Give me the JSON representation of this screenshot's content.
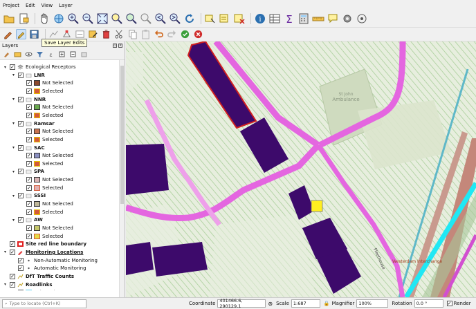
{
  "menu": [
    "Project",
    "Edit",
    "View",
    "Layer"
  ],
  "tooltip": "Save Layer Edits",
  "layers_panel": {
    "title": "Layers",
    "tree": [
      {
        "level": 0,
        "twisty": "▾",
        "checked": true,
        "kind": "group",
        "label": "Ecological Receptors",
        "bold": false
      },
      {
        "level": 1,
        "twisty": "▾",
        "checked": true,
        "kind": "layer",
        "label": "LNR",
        "bold": true
      },
      {
        "level": 2,
        "checked": true,
        "kind": "symbol",
        "fill": "#8b4a2e",
        "border": "#333333",
        "label": "Not Selected"
      },
      {
        "level": 2,
        "checked": true,
        "kind": "symbol",
        "fill": "#d35a3a",
        "border": "#e8c400",
        "label": "Selected"
      },
      {
        "level": 1,
        "twisty": "▾",
        "checked": true,
        "kind": "layer",
        "label": "NNR",
        "bold": true
      },
      {
        "level": 2,
        "checked": true,
        "kind": "symbol",
        "fill": "#6aa84f",
        "border": "#333333",
        "label": "Not Selected"
      },
      {
        "level": 2,
        "checked": true,
        "kind": "symbol",
        "fill": "#d35a3a",
        "border": "#e8c400",
        "label": "Selected"
      },
      {
        "level": 1,
        "twisty": "▾",
        "checked": true,
        "kind": "layer",
        "label": "Ramsar",
        "bold": true
      },
      {
        "level": 2,
        "checked": true,
        "kind": "symbol",
        "fill": "#c8734f",
        "border": "#333333",
        "label": "Not Selected"
      },
      {
        "level": 2,
        "checked": true,
        "kind": "symbol",
        "fill": "#d35a3a",
        "border": "#e8c400",
        "label": "Selected"
      },
      {
        "level": 1,
        "twisty": "▾",
        "checked": true,
        "kind": "layer",
        "label": "SAC",
        "bold": true
      },
      {
        "level": 2,
        "checked": true,
        "kind": "symbol",
        "fill": "#8a8fc0",
        "border": "#333333",
        "label": "Not Selected"
      },
      {
        "level": 2,
        "checked": true,
        "kind": "symbol",
        "fill": "#d35a3a",
        "border": "#e8c400",
        "label": "Selected"
      },
      {
        "level": 1,
        "twisty": "▾",
        "checked": true,
        "kind": "layer",
        "label": "SPA",
        "bold": true
      },
      {
        "level": 2,
        "checked": true,
        "kind": "symbol",
        "fill": "#d9b5b5",
        "border": "#333333",
        "label": "Not Selected"
      },
      {
        "level": 2,
        "checked": true,
        "kind": "symbol",
        "fill": "#e2b0b0",
        "border": "#d35a3a",
        "label": "Selected"
      },
      {
        "level": 1,
        "twisty": "▾",
        "checked": true,
        "kind": "layer",
        "label": "SSSI",
        "bold": true
      },
      {
        "level": 2,
        "checked": true,
        "kind": "symbol",
        "fill": "#c0b89a",
        "border": "#333333",
        "label": "Not Selected"
      },
      {
        "level": 2,
        "checked": true,
        "kind": "symbol",
        "fill": "#d35a3a",
        "border": "#e8c400",
        "label": "Selected"
      },
      {
        "level": 1,
        "twisty": "▾",
        "checked": true,
        "kind": "layer",
        "label": "AW",
        "bold": true
      },
      {
        "level": 2,
        "checked": true,
        "kind": "symbol",
        "fill": "#c5c76b",
        "border": "#333333",
        "label": "Not Selected"
      },
      {
        "level": 2,
        "checked": true,
        "kind": "symbol",
        "fill": "#e8dc48",
        "border": "#d35a3a",
        "label": "Selected"
      },
      {
        "level": 0,
        "checked": true,
        "kind": "layer-symbol",
        "fill": "#ffffff",
        "border": "#e02020",
        "label": "Site red line boundary",
        "bold": true
      },
      {
        "level": 0,
        "twisty": "▾",
        "checked": true,
        "kind": "layer-edit",
        "label": "Monitoring Locations",
        "bold": true,
        "underline": true
      },
      {
        "level": 1,
        "checked": true,
        "kind": "point",
        "label": "Non-Automatic Monitoring"
      },
      {
        "level": 1,
        "checked": true,
        "kind": "point",
        "label": "Automatic Monitoring"
      },
      {
        "level": 0,
        "checked": true,
        "kind": "layer-line",
        "label": "DfT Traffic Counts",
        "bold": true
      },
      {
        "level": 0,
        "twisty": "▾",
        "checked": true,
        "kind": "layer-line",
        "label": "Roadlinks",
        "bold": true
      },
      {
        "level": 1,
        "checked": true,
        "kind": "symbol",
        "fill": "#5ad0f0",
        "border": "#5ad0f0",
        "label": "Selected"
      }
    ]
  },
  "map": {
    "labels": [
      {
        "text": "St John",
        "name": "map-label-st-john"
      },
      {
        "text": "Ambulance",
        "name": "map-label-ambulance"
      },
      {
        "text": "Fleethouse",
        "name": "map-label-fleethouse"
      },
      {
        "text": "Westerdam Interchange",
        "name": "map-label-interchange"
      }
    ]
  },
  "statusbar": {
    "locate_placeholder": "Type to locate (Ctrl+K)",
    "coordinate_label": "Coordinate",
    "coordinate_value": "401466.6, 290129.1",
    "scale_label": "Scale",
    "scale_value": "1:687",
    "magnifier_label": "Magnifier",
    "magnifier_value": "100%",
    "rotation_label": "Rotation",
    "rotation_value": "0.0 °",
    "render_label": "Render"
  },
  "colors": {
    "road": "#e466e0",
    "road_light": "#eea0ea",
    "building": "#3d0a6b",
    "hatch": "#a9cf9a",
    "railway_teal": "#5fb8c8",
    "railway_cyan": "#20e8f4",
    "rail_salmon": "#c4877a",
    "selected_point": "#ffee20"
  }
}
